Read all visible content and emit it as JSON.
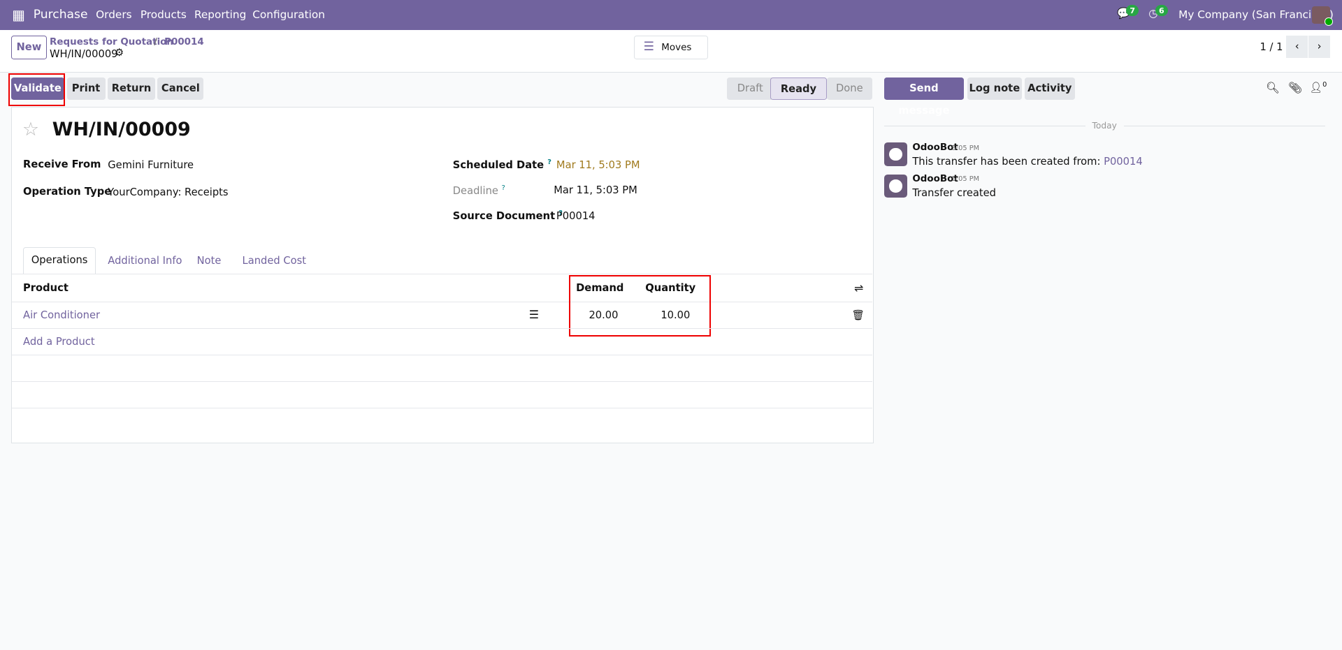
{
  "nav": {
    "app": "Purchase",
    "menus": [
      "Orders",
      "Products",
      "Reporting",
      "Configuration"
    ],
    "messages_count": "7",
    "activities_count": "6",
    "company": "My Company (San Francisco)"
  },
  "control": {
    "new": "New",
    "breadcrumb": [
      "Requests for Quotation",
      "P00014"
    ],
    "record": "WH/IN/00009",
    "moves": "Moves",
    "pager": "1 / 1"
  },
  "actions": {
    "validate": "Validate",
    "print": "Print",
    "return": "Return",
    "cancel": "Cancel"
  },
  "status": {
    "steps": [
      "Draft",
      "Ready",
      "Done"
    ],
    "current": "Ready"
  },
  "form": {
    "title": "WH/IN/00009",
    "receive_from_label": "Receive From",
    "receive_from": "Gemini Furniture",
    "operation_type_label": "Operation Type",
    "operation_type": "YourCompany: Receipts",
    "scheduled_date_label": "Scheduled Date",
    "scheduled_date": "Mar 11, 5:03 PM",
    "deadline_label": "Deadline",
    "deadline": "Mar 11, 5:03 PM",
    "source_document_label": "Source Document",
    "source_document": "P00014",
    "help": "?",
    "tabs": [
      "Operations",
      "Additional Info",
      "Note",
      "Landed Cost"
    ],
    "table": {
      "headers": [
        "Product",
        "Demand",
        "Quantity"
      ],
      "rows": [
        {
          "product": "Air Conditioner",
          "demand": "20.00",
          "quantity": "10.00"
        }
      ],
      "add": "Add a Product"
    }
  },
  "chatter": {
    "send": "Send message",
    "log": "Log note",
    "activity": "Activity",
    "followers": "0",
    "today": "Today",
    "messages": [
      {
        "author": "OdooBot",
        "time": "5:05 PM",
        "text": "This transfer has been created from: ",
        "link": "P00014"
      },
      {
        "author": "OdooBot",
        "time": "5:05 PM",
        "text": "Transfer created"
      }
    ]
  }
}
